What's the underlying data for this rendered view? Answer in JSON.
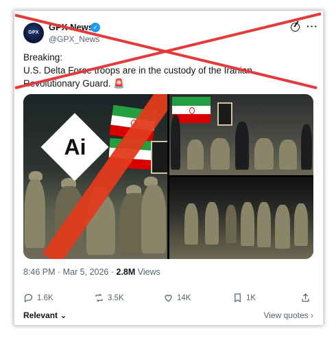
{
  "account": {
    "avatar_text": "GPX",
    "name": "GPX News",
    "handle": "@GPX_News"
  },
  "icons": {
    "verified": "verified-badge-icon",
    "grok": "grok-icon",
    "more": "more-icon",
    "reply": "reply-icon",
    "retweet": "retweet-icon",
    "like": "like-icon",
    "bookmark": "bookmark-icon",
    "share": "share-icon",
    "siren": "siren-icon"
  },
  "tweet": {
    "line1": "Breaking:",
    "line2": "U.S. Delta Force troops are in the custody of the Iranian Revolutionary Guard.",
    "siren": "🚨"
  },
  "media": {
    "ai_label": "Ai"
  },
  "meta": {
    "time": "8:46 PM",
    "date": "Mar 5, 2026",
    "views_count": "2.8M",
    "views_label": "Views"
  },
  "actions": {
    "replies": "1.6K",
    "retweets": "3.5K",
    "likes": "14K",
    "bookmarks": "1K"
  },
  "footer": {
    "relevant": "Relevant",
    "view_quotes": "View quotes"
  },
  "colors": {
    "accent": "#1d9bf0",
    "cross": "#e23b3b",
    "ai_band": "#e23b1c"
  }
}
